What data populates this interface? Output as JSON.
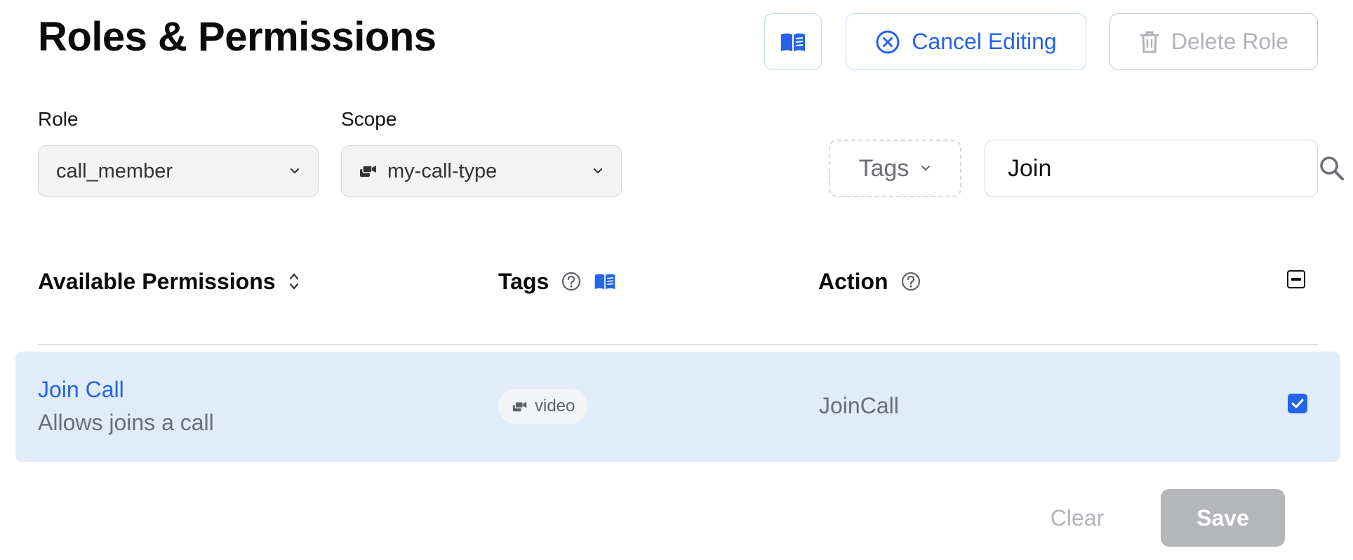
{
  "page": {
    "title": "Roles & Permissions"
  },
  "toolbar": {
    "docs_icon": "open-book-icon",
    "cancel_label": "Cancel Editing",
    "cancel_icon": "circle-x-icon",
    "delete_label": "Delete Role",
    "delete_icon": "trash-icon"
  },
  "filters": {
    "role_label": "Role",
    "role_value": "call_member",
    "scope_label": "Scope",
    "scope_value": "my-call-type",
    "scope_icon": "video-call-icon",
    "tags_label": "Tags",
    "search_value": "Join",
    "search_icon": "search-icon"
  },
  "table": {
    "headers": {
      "permissions": "Available Permissions",
      "tags": "Tags",
      "action": "Action"
    },
    "rows": [
      {
        "name": "Join Call",
        "description": "Allows joins a call",
        "tag": "video",
        "action": "JoinCall",
        "checked": true
      }
    ]
  },
  "footer": {
    "clear_label": "Clear",
    "save_label": "Save"
  },
  "colors": {
    "accent": "#2563eb",
    "selected_row": "#e1ecfb",
    "disabled_text": "#b0b3b8",
    "save_disabled_bg": "#b4b6b9"
  }
}
